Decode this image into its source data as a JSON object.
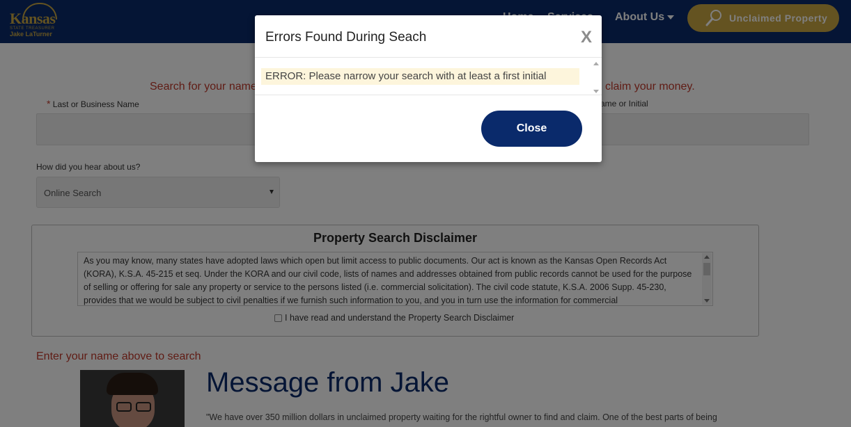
{
  "header": {
    "logo": {
      "name": "Kansas",
      "subtitle": "STATE TREASURER",
      "person": "Jake LaTurner"
    },
    "nav": [
      {
        "label": "Home"
      },
      {
        "label": "Services"
      },
      {
        "label": "About Us"
      }
    ],
    "unclaimed_button": "Unclaimed Property"
  },
  "search": {
    "prompt_left": "Search for your name",
    "prompt_right": "claim your money.",
    "last_name_label": "Last or Business Name",
    "first_name_label": "ame or Initial",
    "hear_label": "How did you hear about us?",
    "hear_value": "Online Search"
  },
  "disclaimer": {
    "title": "Property Search Disclaimer",
    "text": "As you may know, many states have adopted laws which open but limit access to public documents. Our act is known as the Kansas Open Records Act (KORA), K.S.A. 45-215 et seq. Under the KORA and our civil code, lists of names and addresses obtained from public records cannot be used for the purpose of selling or offering for sale any property or service to the persons listed (i.e. commercial solicitation). The civil code statute, K.S.A. 2006 Supp. 45-230, provides that we would be subject to civil penalties if we furnish such information to you, and you in turn use the information for commercial",
    "checkbox_label": "I have read and understand the Property Search Disclaimer"
  },
  "enter_name_message": "Enter your name above to search",
  "message": {
    "title": "Message from Jake",
    "body": "\"We have over 350 million dollars in unclaimed property waiting for the rightful owner to find and claim.  One of the best parts of being"
  },
  "modal": {
    "title": "Errors Found During Seach",
    "close_x": "X",
    "error": "ERROR: Please narrow your search with at least a first initial",
    "close_button": "Close"
  }
}
